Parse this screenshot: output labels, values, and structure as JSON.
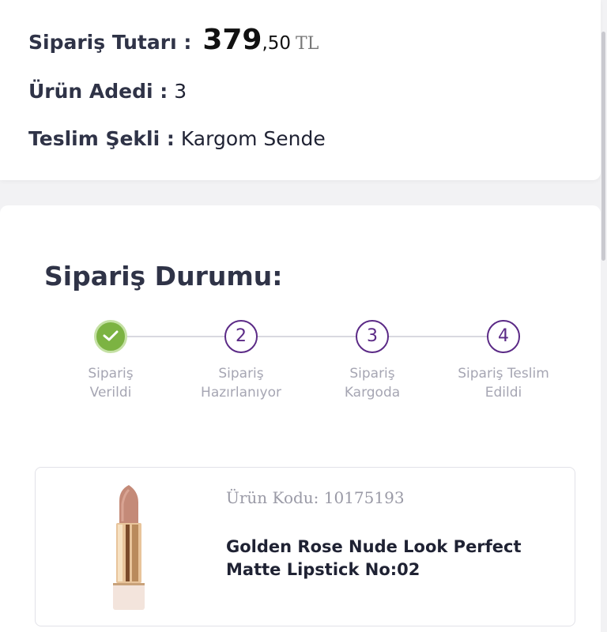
{
  "summary": {
    "total_label": "Sipariş Tutarı :",
    "total_int": "379",
    "total_dec": ",50",
    "currency": "TL",
    "qty_label": "Ürün Adedi :",
    "qty_value": "3",
    "shipping_label": "Teslim Şekli :",
    "shipping_value": "Kargom Sende"
  },
  "status": {
    "title": "Sipariş Durumu:",
    "steps": [
      {
        "number": "",
        "line1": "Sipariş",
        "line2": "Verildi",
        "done": true,
        "icon": "check-icon"
      },
      {
        "number": "2",
        "line1": "Sipariş",
        "line2": "Hazırlanıyor",
        "done": false
      },
      {
        "number": "3",
        "line1": "Sipariş",
        "line2": "Kargoda",
        "done": false
      },
      {
        "number": "4",
        "line1": "Sipariş Teslim",
        "line2": "Edildi",
        "done": false
      }
    ]
  },
  "product": {
    "code": "Ürün Kodu: 10175193",
    "name": "Golden Rose Nude Look Perfect Matte Lipstick No:02",
    "image_icon": "lipstick-image"
  },
  "colors": {
    "accent_purple": "#5b2a86",
    "done_green": "#7cb342",
    "muted_text": "#a6a6b3"
  }
}
